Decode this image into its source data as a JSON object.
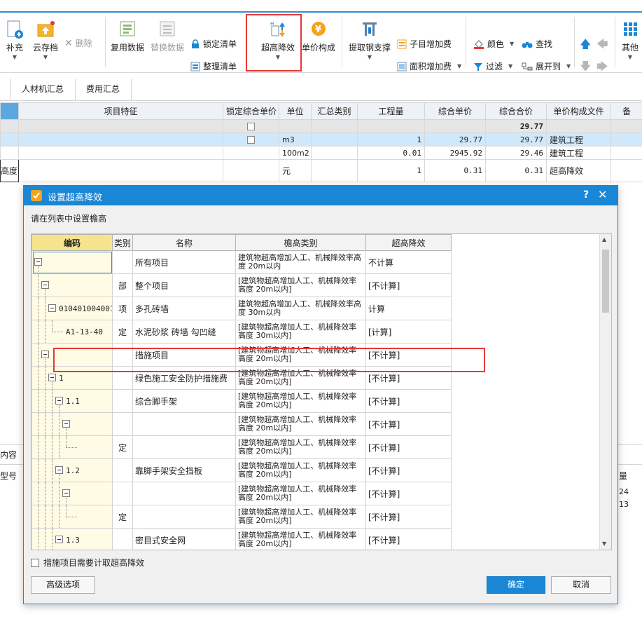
{
  "toolbar": {
    "supplement": "补充",
    "cloud_save": "云存档",
    "delete": "删除",
    "reuse_data": "复用数据",
    "replace_data": "替换数据",
    "lock_list": "锁定清单",
    "organize_list": "整理清单",
    "super_height": "超高降效",
    "unit_price": "单价构成",
    "extract_steel": "提取钢支撑",
    "sub_item_add": "子目增加费",
    "area_add": "面积增加费",
    "color": "颜色",
    "search": "查找",
    "filter": "过滤",
    "expand_to": "展开到",
    "other": "其他"
  },
  "tabs": [
    "人材机汇总",
    "费用汇总"
  ],
  "bg_table": {
    "headers": [
      "项目特征",
      "锁定综合单价",
      "单位",
      "汇总类别",
      "工程量",
      "综合单价",
      "综合合价",
      "单价构成文件",
      "备"
    ],
    "rows": [
      {
        "feature": "",
        "unit": "",
        "qty": "",
        "price": "",
        "total": "29.77",
        "file": ""
      },
      {
        "feature": "",
        "unit": "m3",
        "qty": "1",
        "price": "29.77",
        "total": "29.77",
        "file": "建筑工程"
      },
      {
        "feature": "",
        "unit": "100m2",
        "qty": "0.01",
        "price": "2945.92",
        "total": "29.46",
        "file": "建筑工程"
      },
      {
        "feature": "高度",
        "unit": "元",
        "qty": "1",
        "price": "0.31",
        "total": "0.31",
        "file": "超高降效"
      }
    ],
    "left_labels": [
      "内容",
      "型号"
    ],
    "right_labels": [
      "量",
      "24",
      "13"
    ]
  },
  "dialog": {
    "title": "设置超高降效",
    "help": "?",
    "close": "✕",
    "instruction": "请在列表中设置檐高",
    "columns": [
      "编码",
      "类别",
      "名称",
      "檐高类别",
      "超高降效"
    ],
    "rows": [
      {
        "code": "",
        "type": "",
        "name": "所有项目",
        "level": "建筑物超高增加人工、机械降效率高度 20m以内",
        "effect": "不计算"
      },
      {
        "code": "",
        "type": "部",
        "name": "整个项目",
        "level": "[建筑物超高增加人工、机械降效率 高度 20m以内]",
        "effect": "[不计算]"
      },
      {
        "code": "010401004001",
        "type": "项",
        "name": "多孔砖墙",
        "level": "建筑物超高增加人工、机械降效率高度 30m以内",
        "effect": "计算"
      },
      {
        "code": "A1-13-40",
        "type": "定",
        "name": "水泥砂浆 砖墙 勾凹缝",
        "level": "[建筑物超高增加人工、机械降效率 高度 30m以内]",
        "effect": "[计算]"
      },
      {
        "code": "",
        "type": "",
        "name": "措施项目",
        "level": "[建筑物超高增加人工、机械降效率 高度 20m以内]",
        "effect": "[不计算]"
      },
      {
        "code": "1",
        "type": "",
        "name": "绿色施工安全防护措施费",
        "level": "[建筑物超高增加人工、机械降效率 高度 20m以内]",
        "effect": "[不计算]"
      },
      {
        "code": "1.1",
        "type": "",
        "name": "综合脚手架",
        "level": "[建筑物超高增加人工、机械降效率 高度 20m以内]",
        "effect": "[不计算]"
      },
      {
        "code": "",
        "type": "",
        "name": "",
        "level": "[建筑物超高增加人工、机械降效率 高度 20m以内]",
        "effect": "[不计算]"
      },
      {
        "code": "",
        "type": "定",
        "name": "",
        "level": "[建筑物超高增加人工、机械降效率 高度 20m以内]",
        "effect": "[不计算]"
      },
      {
        "code": "1.2",
        "type": "",
        "name": "靠脚手架安全挡板",
        "level": "[建筑物超高增加人工、机械降效率 高度 20m以内]",
        "effect": "[不计算]"
      },
      {
        "code": "",
        "type": "",
        "name": "",
        "level": "[建筑物超高增加人工、机械降效率 高度 20m以内]",
        "effect": "[不计算]"
      },
      {
        "code": "",
        "type": "定",
        "name": "",
        "level": "[建筑物超高增加人工、机械降效率 高度 20m以内]",
        "effect": "[不计算]"
      },
      {
        "code": "1.3",
        "type": "",
        "name": "密目式安全网",
        "level": "[建筑物超高增加人工、机械降效率 高度 20m以内]",
        "effect": "[不计算]"
      }
    ],
    "checkbox_label": "措施项目需要计取超高降效",
    "advanced_button": "高级选项",
    "ok_button": "确定",
    "cancel_button": "取消"
  },
  "colors": {
    "accent": "#1a86d6",
    "highlight": "#e53935",
    "selected_row": "#cfe8fb"
  }
}
